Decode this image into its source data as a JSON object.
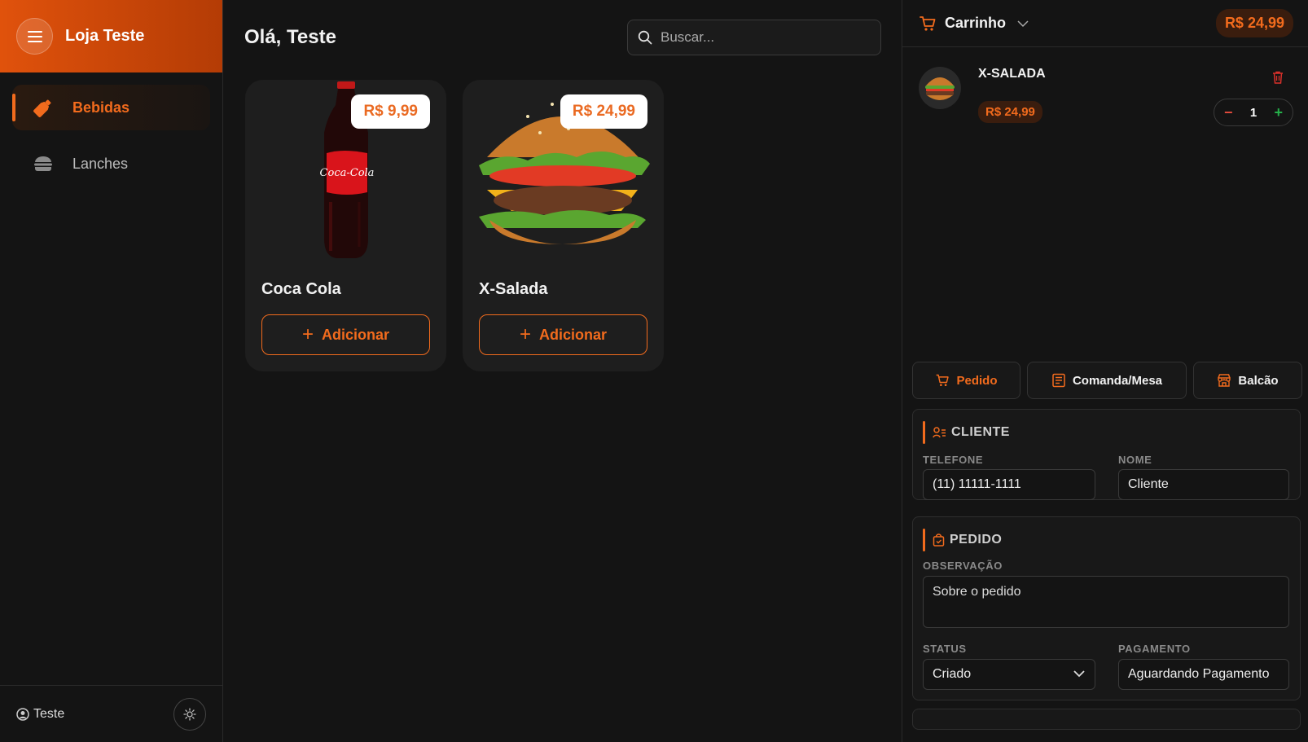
{
  "sidebar": {
    "brand": "Loja Teste",
    "items": [
      {
        "label": "Bebidas",
        "icon": "bottle-icon",
        "active": true
      },
      {
        "label": "Lanches",
        "icon": "burger-icon",
        "active": false
      }
    ],
    "user": "Teste"
  },
  "main": {
    "greeting": "Olá, Teste",
    "search_placeholder": "Buscar...",
    "products": [
      {
        "name": "Coca Cola",
        "price": "R$ 9,99",
        "add_label": "Adicionar"
      },
      {
        "name": "X-Salada",
        "price": "R$ 24,99",
        "add_label": "Adicionar"
      }
    ]
  },
  "cart": {
    "title": "Carrinho",
    "total": "R$ 24,99",
    "items": [
      {
        "name": "X-SALADA",
        "price": "R$ 24,99",
        "qty": "1"
      }
    ],
    "tabs": [
      {
        "label": "Pedido",
        "active": true
      },
      {
        "label": "Comanda/Mesa",
        "active": false
      },
      {
        "label": "Balcão",
        "active": false
      }
    ],
    "cliente": {
      "title": "CLIENTE",
      "telefone_label": "TELEFONE",
      "telefone_value": "(11) 11111-1111",
      "nome_label": "NOME",
      "nome_value": "Cliente"
    },
    "pedido": {
      "title": "PEDIDO",
      "obs_label": "OBSERVAÇÃO",
      "obs_placeholder": "Sobre o pedido",
      "status_label": "STATUS",
      "status_value": "Criado",
      "pagamento_label": "PAGAMENTO",
      "pagamento_value": "Aguardando Pagamento"
    }
  },
  "colors": {
    "accent": "#f26b1d",
    "background": "#141414",
    "card": "#1e1e1e"
  }
}
